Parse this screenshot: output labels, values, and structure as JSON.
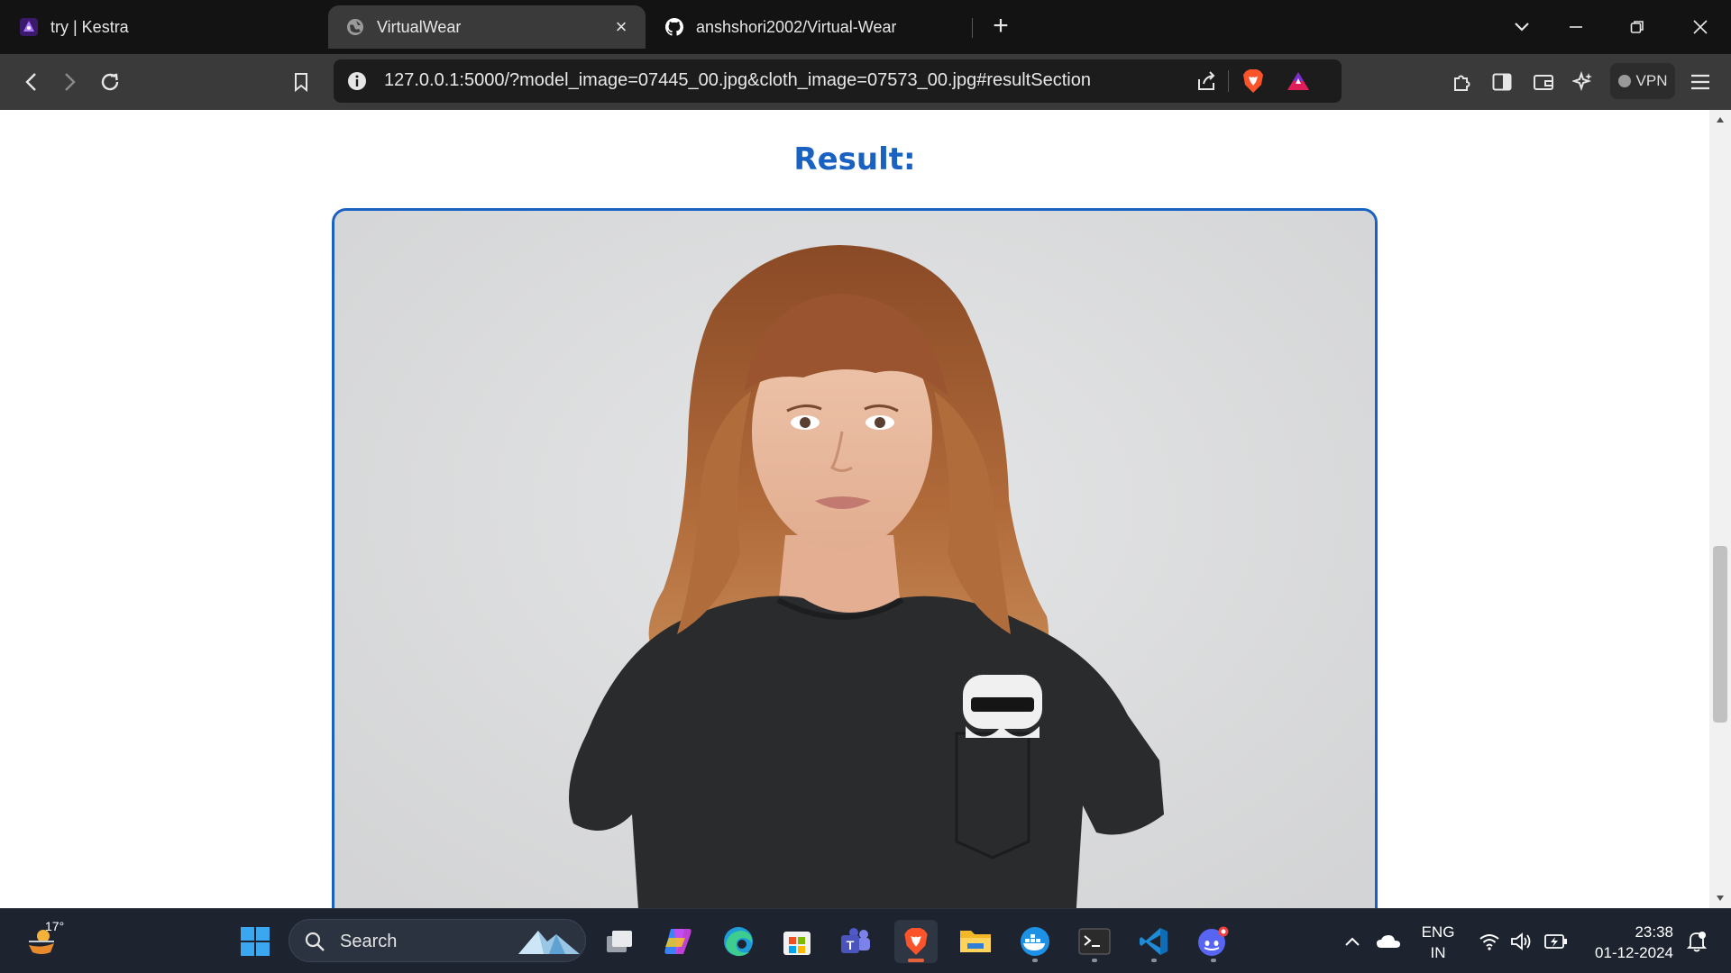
{
  "browser": {
    "tabs": [
      {
        "title": "try | Kestra",
        "icon": "kestra-icon",
        "active": false
      },
      {
        "title": "VirtualWear",
        "icon": "globe-icon",
        "active": true
      },
      {
        "title": "anshshori2002/Virtual-Wear",
        "icon": "github-icon",
        "active": false
      }
    ],
    "url": "127.0.0.1:5000/?model_image=07445_00.jpg&cloth_image=07573_00.jpg#resultSection",
    "vpn_label": "VPN",
    "accent": "#1a62c2"
  },
  "page": {
    "result_heading": "Result:",
    "result_image_alt": "Model wearing the selected black t-shirt"
  },
  "taskbar": {
    "weather_temp": "17°",
    "search_placeholder": "Search",
    "language": "ENG",
    "region": "IN",
    "time": "23:38",
    "date": "01-12-2024",
    "apps": [
      "windows-start",
      "task-view",
      "copilot",
      "edge",
      "microsoft-store",
      "teams",
      "brave",
      "file-explorer",
      "docker",
      "terminal",
      "vscode",
      "discord"
    ]
  }
}
